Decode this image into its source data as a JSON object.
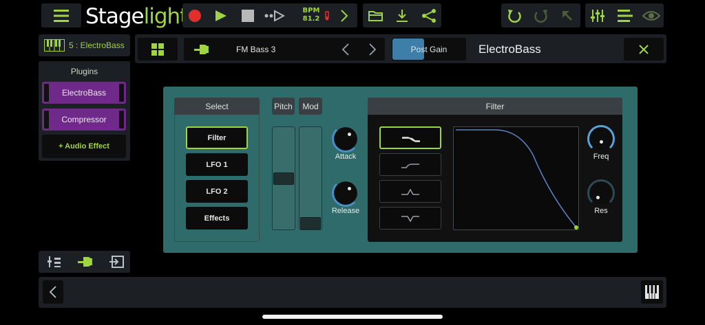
{
  "app": {
    "logo_stage": "Stage",
    "logo_light": "light"
  },
  "transport": {
    "bpm_label": "BPM",
    "bpm_value": "81.2"
  },
  "track": {
    "label": "5 : ElectroBass"
  },
  "plugins": {
    "heading": "Plugins",
    "items": [
      {
        "label": "ElectroBass"
      },
      {
        "label": "Compressor"
      }
    ],
    "add_label": "+ Audio Effect"
  },
  "preset": {
    "name": "FM Bass 3",
    "post_gain_label": "Post Gain",
    "post_gain_level": 0.43,
    "instrument_title": "ElectroBass"
  },
  "select": {
    "heading": "Select",
    "items": [
      {
        "label": "Filter",
        "active": true
      },
      {
        "label": "LFO 1"
      },
      {
        "label": "LFO 2"
      },
      {
        "label": "Effects"
      }
    ]
  },
  "pitch_mod": {
    "pitch_label": "Pitch",
    "mod_label": "Mod",
    "pitch_value": 0.5,
    "mod_value": 0.0
  },
  "envelope": {
    "attack_label": "Attack",
    "release_label": "Release"
  },
  "filter": {
    "heading": "Filter",
    "types": [
      "lowpass",
      "highpass",
      "bandpass",
      "notch"
    ],
    "active_type": "lowpass",
    "freq_label": "Freq",
    "res_label": "Res"
  },
  "colors": {
    "accent": "#9fd442",
    "record": "#e0302c",
    "plugin": "#6f2a89",
    "teal": "#2f6b6a",
    "knob_ring": "#4a8fc2"
  }
}
